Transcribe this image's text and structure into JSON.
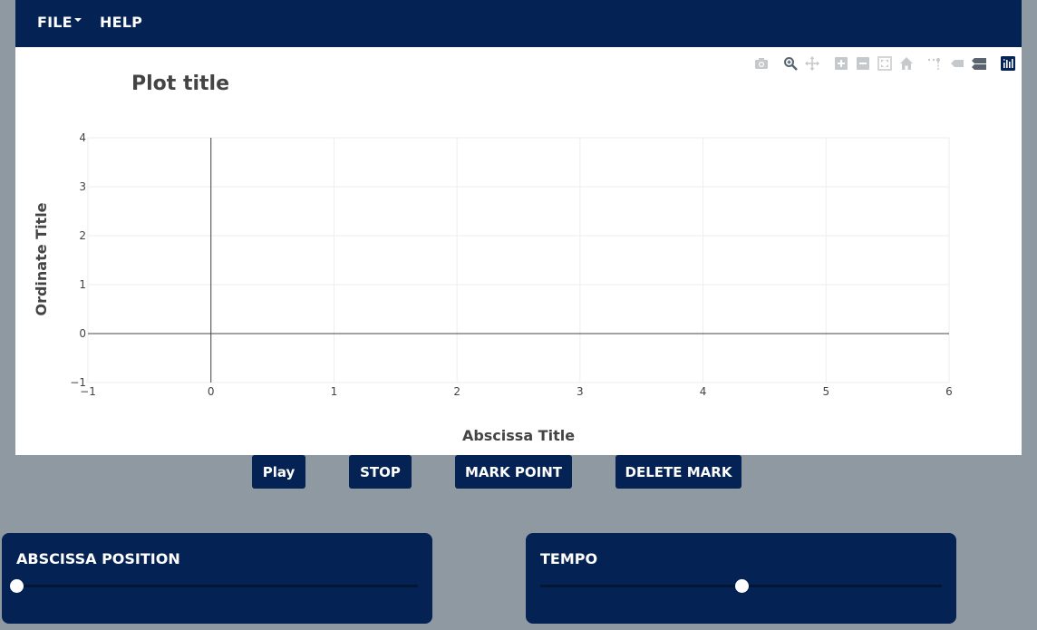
{
  "navbar": {
    "file_label": "FILE",
    "help_label": "HELP"
  },
  "modebar": {
    "buttons": [
      "camera-icon",
      "zoom-icon",
      "pan-icon",
      "zoom-in-icon",
      "zoom-out-icon",
      "autoscale-icon",
      "reset-axes-icon",
      "spike-lines-icon",
      "hover-closest-icon",
      "hover-compare-icon",
      "plotly-logo-icon"
    ]
  },
  "chart_data": {
    "type": "line",
    "title": "Plot title",
    "xlabel": "Abscissa Title",
    "ylabel": "Ordinate Title",
    "xlim": [
      -1,
      6
    ],
    "ylim": [
      -1,
      4
    ],
    "x_ticks": [
      "−1",
      "0",
      "1",
      "2",
      "3",
      "4",
      "5",
      "6"
    ],
    "y_ticks": [
      "−1",
      "0",
      "1",
      "2",
      "3",
      "4"
    ],
    "grid": true,
    "series": []
  },
  "controls": {
    "play_label": "Play",
    "stop_label": "STOP",
    "mark_label": "MARK POINT",
    "delete_label": "DELETE MARK"
  },
  "sliders": {
    "abscissa": {
      "label": "ABSCISSA POSITION",
      "value_fraction": 0.0
    },
    "tempo": {
      "label": "TEMPO",
      "value_fraction": 0.5
    }
  },
  "colors": {
    "nav_bg": "#042253",
    "page_bg": "#8f99a2",
    "text_dark": "#444444"
  }
}
